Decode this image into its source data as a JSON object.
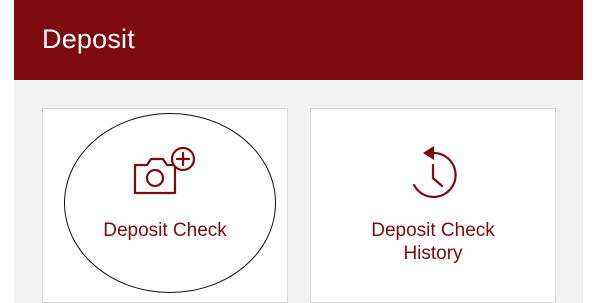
{
  "header": {
    "title": "Deposit",
    "background_color": "#7d0a0f"
  },
  "tiles": [
    {
      "label": "Deposit Check",
      "icon": "camera-add-icon",
      "highlighted": true
    },
    {
      "label_line1": "Deposit Check",
      "label_line2": "History",
      "icon": "history-clock-icon"
    }
  ],
  "colors": {
    "accent": "#7d0a0f",
    "tile_background": "#ffffff",
    "panel_background": "#f2f2f2"
  }
}
